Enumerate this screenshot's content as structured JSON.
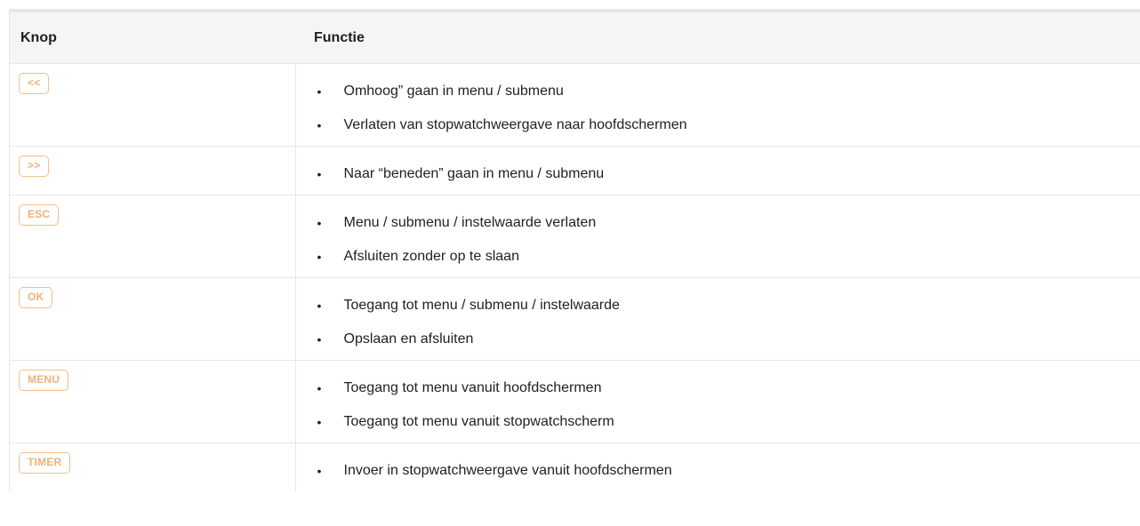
{
  "table": {
    "headers": {
      "knop": "Knop",
      "functie": "Functie"
    },
    "rows": [
      {
        "key": "<<",
        "functions": [
          "Omhoog” gaan in menu / submenu",
          "Verlaten van stopwatchweergave naar hoofdschermen"
        ]
      },
      {
        "key": ">>",
        "functions": [
          "Naar “beneden” gaan in menu / submenu"
        ]
      },
      {
        "key": "ESC",
        "functions": [
          "Menu / submenu / instelwaarde verlaten",
          "Afsluiten zonder op te slaan"
        ]
      },
      {
        "key": "OK",
        "functions": [
          "Toegang tot menu / submenu / instelwaarde",
          "Opslaan en afsluiten"
        ]
      },
      {
        "key": "MENU",
        "functions": [
          "Toegang tot menu vanuit hoofdschermen",
          "Toegang tot menu vanuit stopwatchscherm"
        ]
      },
      {
        "key": "TIMER",
        "functions": [
          "Invoer in stopwatchweergave vanuit hoofdschermen"
        ]
      }
    ],
    "bullet": "•"
  },
  "colors": {
    "key_border": "#f2be8e",
    "key_text": "#f0b07a",
    "header_bg": "#f5f5f5",
    "grid_line": "#e6e6e6"
  }
}
